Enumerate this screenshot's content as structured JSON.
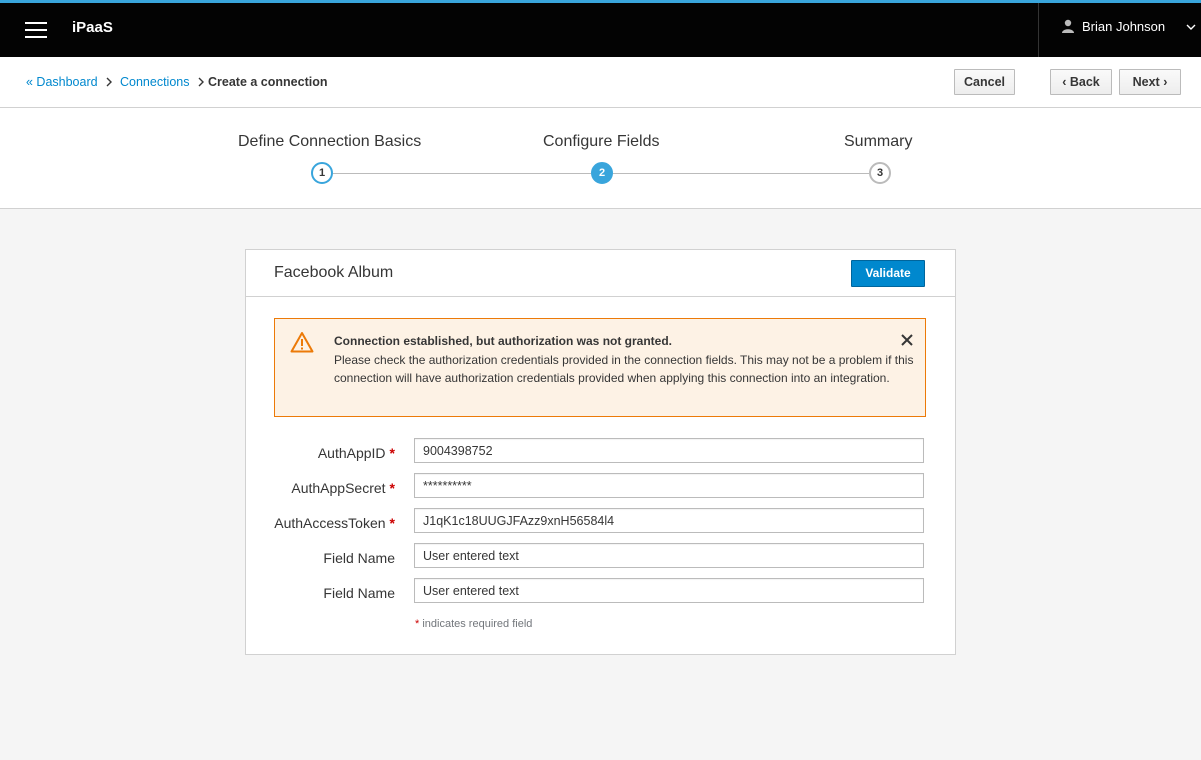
{
  "nav": {
    "brand": "iPaaS",
    "user_name": "Brian Johnson"
  },
  "breadcrumb": {
    "dashboard": "« Dashboard",
    "connections": "Connections",
    "current": "Create a connection"
  },
  "toolbar": {
    "cancel_label": "Cancel",
    "back_label": "‹ Back",
    "next_label": "Next ›"
  },
  "wizard": {
    "steps": [
      {
        "label": "Define Connection Basics",
        "number": "1",
        "state": "done"
      },
      {
        "label": "Configure Fields",
        "number": "2",
        "state": "active"
      },
      {
        "label": "Summary",
        "number": "3",
        "state": "pending"
      }
    ]
  },
  "card": {
    "title": "Facebook Album",
    "validate_label": "Validate"
  },
  "alert": {
    "title": "Connection established, but authorization was not granted.",
    "body": "Please check the authorization credentials provided in the connection fields.  This may not be a problem if this connection will have authorization credentials provided when applying this connection into an integration."
  },
  "fields": [
    {
      "label": "AuthAppID",
      "required": "*",
      "value": "9004398752"
    },
    {
      "label": "AuthAppSecret",
      "required": "*",
      "value": "**********"
    },
    {
      "label": "AuthAccessToken",
      "required": "*",
      "value": "J1qK1c18UUGJFAzz9xnH56584l4"
    },
    {
      "label": "Field Name",
      "required": "",
      "value": "User entered text"
    },
    {
      "label": "Field Name",
      "required": "",
      "value": "User entered text"
    }
  ],
  "required_note": {
    "star": "*",
    "text": " indicates required field"
  },
  "colors": {
    "accent": "#39a5dc",
    "primary_button": "#0088ce",
    "warning": "#ec7a08",
    "warning_bg": "#fdf2e5",
    "required": "#cc0000"
  }
}
